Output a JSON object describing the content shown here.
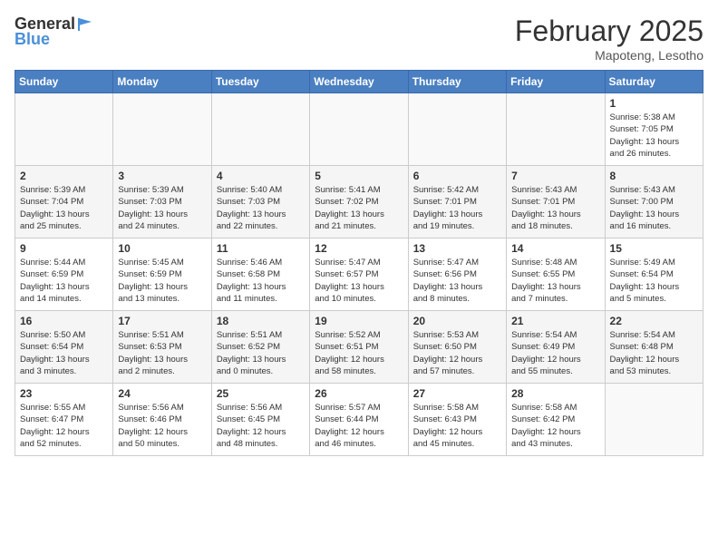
{
  "header": {
    "logo_general": "General",
    "logo_blue": "Blue",
    "month": "February 2025",
    "location": "Mapoteng, Lesotho"
  },
  "weekdays": [
    "Sunday",
    "Monday",
    "Tuesday",
    "Wednesday",
    "Thursday",
    "Friday",
    "Saturday"
  ],
  "weeks": [
    [
      {
        "day": "",
        "info": ""
      },
      {
        "day": "",
        "info": ""
      },
      {
        "day": "",
        "info": ""
      },
      {
        "day": "",
        "info": ""
      },
      {
        "day": "",
        "info": ""
      },
      {
        "day": "",
        "info": ""
      },
      {
        "day": "1",
        "info": "Sunrise: 5:38 AM\nSunset: 7:05 PM\nDaylight: 13 hours\nand 26 minutes."
      }
    ],
    [
      {
        "day": "2",
        "info": "Sunrise: 5:39 AM\nSunset: 7:04 PM\nDaylight: 13 hours\nand 25 minutes."
      },
      {
        "day": "3",
        "info": "Sunrise: 5:39 AM\nSunset: 7:03 PM\nDaylight: 13 hours\nand 24 minutes."
      },
      {
        "day": "4",
        "info": "Sunrise: 5:40 AM\nSunset: 7:03 PM\nDaylight: 13 hours\nand 22 minutes."
      },
      {
        "day": "5",
        "info": "Sunrise: 5:41 AM\nSunset: 7:02 PM\nDaylight: 13 hours\nand 21 minutes."
      },
      {
        "day": "6",
        "info": "Sunrise: 5:42 AM\nSunset: 7:01 PM\nDaylight: 13 hours\nand 19 minutes."
      },
      {
        "day": "7",
        "info": "Sunrise: 5:43 AM\nSunset: 7:01 PM\nDaylight: 13 hours\nand 18 minutes."
      },
      {
        "day": "8",
        "info": "Sunrise: 5:43 AM\nSunset: 7:00 PM\nDaylight: 13 hours\nand 16 minutes."
      }
    ],
    [
      {
        "day": "9",
        "info": "Sunrise: 5:44 AM\nSunset: 6:59 PM\nDaylight: 13 hours\nand 14 minutes."
      },
      {
        "day": "10",
        "info": "Sunrise: 5:45 AM\nSunset: 6:59 PM\nDaylight: 13 hours\nand 13 minutes."
      },
      {
        "day": "11",
        "info": "Sunrise: 5:46 AM\nSunset: 6:58 PM\nDaylight: 13 hours\nand 11 minutes."
      },
      {
        "day": "12",
        "info": "Sunrise: 5:47 AM\nSunset: 6:57 PM\nDaylight: 13 hours\nand 10 minutes."
      },
      {
        "day": "13",
        "info": "Sunrise: 5:47 AM\nSunset: 6:56 PM\nDaylight: 13 hours\nand 8 minutes."
      },
      {
        "day": "14",
        "info": "Sunrise: 5:48 AM\nSunset: 6:55 PM\nDaylight: 13 hours\nand 7 minutes."
      },
      {
        "day": "15",
        "info": "Sunrise: 5:49 AM\nSunset: 6:54 PM\nDaylight: 13 hours\nand 5 minutes."
      }
    ],
    [
      {
        "day": "16",
        "info": "Sunrise: 5:50 AM\nSunset: 6:54 PM\nDaylight: 13 hours\nand 3 minutes."
      },
      {
        "day": "17",
        "info": "Sunrise: 5:51 AM\nSunset: 6:53 PM\nDaylight: 13 hours\nand 2 minutes."
      },
      {
        "day": "18",
        "info": "Sunrise: 5:51 AM\nSunset: 6:52 PM\nDaylight: 13 hours\nand 0 minutes."
      },
      {
        "day": "19",
        "info": "Sunrise: 5:52 AM\nSunset: 6:51 PM\nDaylight: 12 hours\nand 58 minutes."
      },
      {
        "day": "20",
        "info": "Sunrise: 5:53 AM\nSunset: 6:50 PM\nDaylight: 12 hours\nand 57 minutes."
      },
      {
        "day": "21",
        "info": "Sunrise: 5:54 AM\nSunset: 6:49 PM\nDaylight: 12 hours\nand 55 minutes."
      },
      {
        "day": "22",
        "info": "Sunrise: 5:54 AM\nSunset: 6:48 PM\nDaylight: 12 hours\nand 53 minutes."
      }
    ],
    [
      {
        "day": "23",
        "info": "Sunrise: 5:55 AM\nSunset: 6:47 PM\nDaylight: 12 hours\nand 52 minutes."
      },
      {
        "day": "24",
        "info": "Sunrise: 5:56 AM\nSunset: 6:46 PM\nDaylight: 12 hours\nand 50 minutes."
      },
      {
        "day": "25",
        "info": "Sunrise: 5:56 AM\nSunset: 6:45 PM\nDaylight: 12 hours\nand 48 minutes."
      },
      {
        "day": "26",
        "info": "Sunrise: 5:57 AM\nSunset: 6:44 PM\nDaylight: 12 hours\nand 46 minutes."
      },
      {
        "day": "27",
        "info": "Sunrise: 5:58 AM\nSunset: 6:43 PM\nDaylight: 12 hours\nand 45 minutes."
      },
      {
        "day": "28",
        "info": "Sunrise: 5:58 AM\nSunset: 6:42 PM\nDaylight: 12 hours\nand 43 minutes."
      },
      {
        "day": "",
        "info": ""
      }
    ]
  ]
}
